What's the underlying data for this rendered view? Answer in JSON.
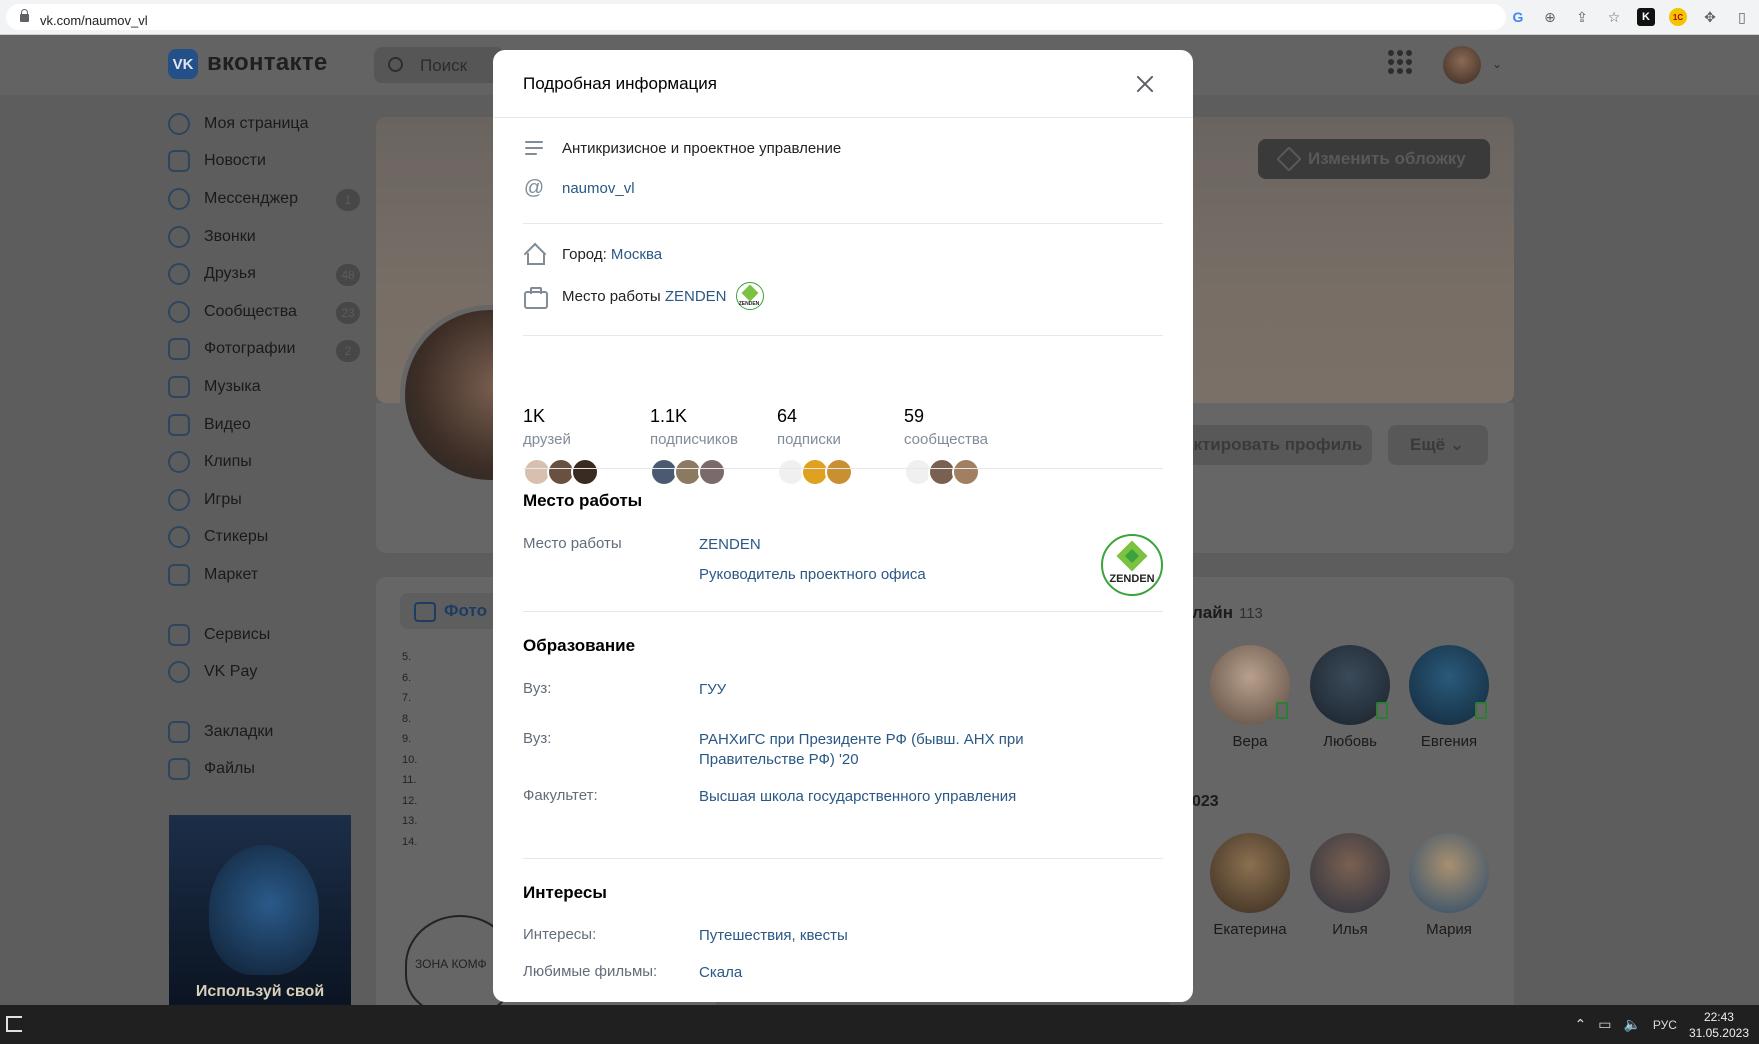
{
  "browser": {
    "url": "vk.com/naumov_vl",
    "toolbar_icons": [
      "google-icon",
      "zoom-icon",
      "share-icon",
      "star-icon",
      "kaspersky-icon",
      "1c-icon",
      "extensions-icon",
      "sidepanel-icon"
    ]
  },
  "vk": {
    "brand": "вконтакте",
    "search_placeholder": "Поиск",
    "cover_button": "Изменить обложку",
    "edit_profile": "актировать профиль",
    "more": "Ещё",
    "photos_tab": "Фото",
    "photo_caption": "ЗОНА КОМФ",
    "emoji_rows": [
      "5.",
      "6.",
      "7.",
      "8.",
      "9.",
      "10.",
      "11.",
      "12.",
      "13.",
      "14."
    ],
    "promo_text": "Используй свой"
  },
  "sidebar": {
    "items": [
      {
        "label": "Моя страница",
        "badge": ""
      },
      {
        "label": "Новости",
        "badge": ""
      },
      {
        "label": "Мессенджер",
        "badge": "1"
      },
      {
        "label": "Звонки",
        "badge": ""
      },
      {
        "label": "Друзья",
        "badge": "48"
      },
      {
        "label": "Сообщества",
        "badge": "23"
      },
      {
        "label": "Фотографии",
        "badge": "2"
      },
      {
        "label": "Музыка",
        "badge": ""
      },
      {
        "label": "Видео",
        "badge": ""
      },
      {
        "label": "Клипы",
        "badge": ""
      },
      {
        "label": "Игры",
        "badge": ""
      },
      {
        "label": "Стикеры",
        "badge": ""
      },
      {
        "label": "Маркет",
        "badge": ""
      }
    ],
    "items2": [
      {
        "label": "Сервисы"
      },
      {
        "label": "VK Pay"
      }
    ],
    "items3": [
      {
        "label": "Закладки"
      },
      {
        "label": "Файлы"
      }
    ]
  },
  "friends_panel": {
    "title": "лайн",
    "count": "113",
    "subtitle": "023",
    "online": [
      "Вера",
      "Любовь",
      "Евгения"
    ],
    "birthdays": [
      "Екатерина",
      "Илья",
      "Мария"
    ]
  },
  "modal": {
    "title": "Подробная информация",
    "status": "Антикризисное и проектное управление",
    "nickname": "naumov_vl",
    "city_label": "Город:",
    "city": "Москва",
    "work_label": "Место работы",
    "work_company": "ZENDEN",
    "logo_text": "ZENDEN",
    "counters": [
      {
        "num": "1K",
        "label": "друзей"
      },
      {
        "num": "1.1K",
        "label": "подписчиков"
      },
      {
        "num": "64",
        "label": "подписки"
      },
      {
        "num": "59",
        "label": "сообщества"
      }
    ],
    "work_section": {
      "title": "Место работы",
      "key": "Место работы",
      "company": "ZENDEN",
      "position": "Руководитель проектного офиса"
    },
    "education": {
      "title": "Образование",
      "rows": [
        {
          "key": "Вуз:",
          "value": "ГУУ"
        },
        {
          "key": "Вуз:",
          "value": "РАНХиГС при Президенте РФ (бывш. АНХ при Правительстве РФ) '20"
        },
        {
          "key": "Факультет:",
          "value": "Высшая школа государственного управления"
        }
      ]
    },
    "interests": {
      "title": "Интересы",
      "rows": [
        {
          "key": "Интересы:",
          "value": "Путешествия, квесты"
        },
        {
          "key": "Любимые фильмы:",
          "value": "Скала"
        }
      ]
    }
  },
  "taskbar": {
    "lang": "РУС",
    "time": "22:43",
    "date": "31.05.2023"
  }
}
